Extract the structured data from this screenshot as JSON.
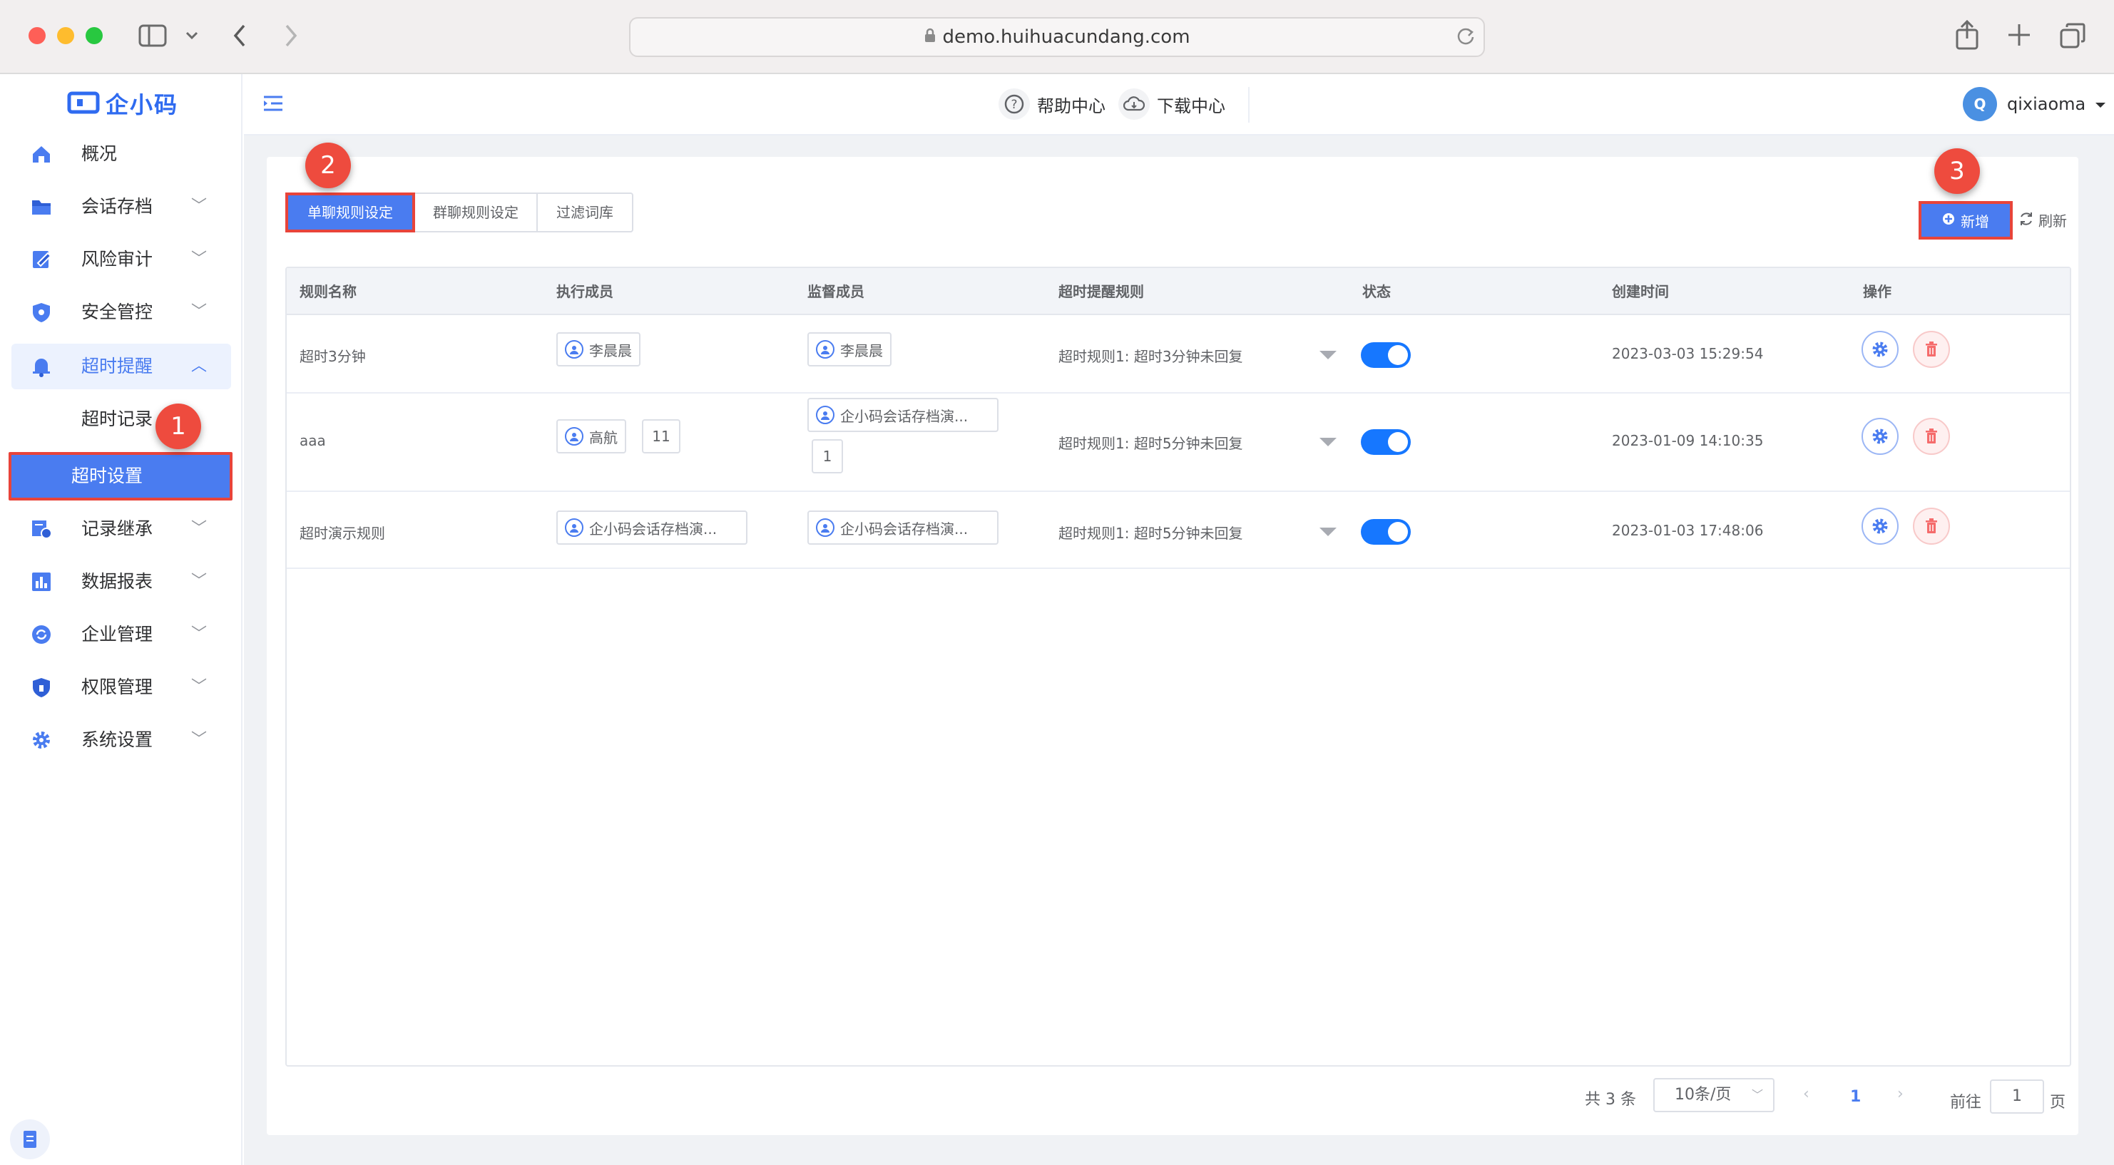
{
  "browser": {
    "url": "demo.huihuacundang.com"
  },
  "brand": {
    "logo": "企小码"
  },
  "sidebar": {
    "items": [
      {
        "label": "概况",
        "icon": "home-icon"
      },
      {
        "label": "会话存档",
        "icon": "folder-icon"
      },
      {
        "label": "风险审计",
        "icon": "audit-icon"
      },
      {
        "label": "安全管控",
        "icon": "shield-icon"
      },
      {
        "label": "超时提醒",
        "icon": "bell-icon"
      },
      {
        "label": "超时记录"
      },
      {
        "label": "超时设置"
      },
      {
        "label": "记录继承",
        "icon": "inherit-icon"
      },
      {
        "label": "数据报表",
        "icon": "chart-icon"
      },
      {
        "label": "企业管理",
        "icon": "enterprise-icon"
      },
      {
        "label": "权限管理",
        "icon": "permission-icon"
      },
      {
        "label": "系统设置",
        "icon": "gear-icon"
      }
    ]
  },
  "header": {
    "help": "帮助中心",
    "download": "下载中心",
    "avatar_letter": "Q",
    "username": "qixiaoma"
  },
  "tabs": [
    "单聊规则设定",
    "群聊规则设定",
    "过滤词库"
  ],
  "actions": {
    "add": "新增",
    "refresh": "刷新"
  },
  "table": {
    "columns": [
      "规则名称",
      "执行成员",
      "监督成员",
      "超时提醒规则",
      "状态",
      "创建时间",
      "操作"
    ],
    "rows": [
      {
        "name": "超时3分钟",
        "exec": "李晨晨",
        "exec_extra": "",
        "sup": "李晨晨",
        "sup_extra": "",
        "rule": "超时规则1: 超时3分钟未回复",
        "created": "2023-03-03 15:29:54"
      },
      {
        "name": "aaa",
        "exec": "高航",
        "exec_extra": "11",
        "sup": "企小码会话存档演...",
        "sup_extra": "1",
        "rule": "超时规则1: 超时5分钟未回复",
        "created": "2023-01-09 14:10:35"
      },
      {
        "name": "超时演示规则",
        "exec": "企小码会话存档演...",
        "exec_extra": "",
        "sup": "企小码会话存档演...",
        "sup_extra": "",
        "rule": "超时规则1: 超时5分钟未回复",
        "created": "2023-01-03 17:48:06"
      }
    ]
  },
  "pagination": {
    "total": "共 3 条",
    "page_size": "10条/页",
    "current": "1",
    "goto_prefix": "前往",
    "goto_value": "1",
    "goto_suffix": "页"
  },
  "annotations": [
    "1",
    "2",
    "3"
  ],
  "colors": {
    "accent": "#4a7cf0",
    "highlight": "#e8443a",
    "toggle": "#1677ff"
  }
}
